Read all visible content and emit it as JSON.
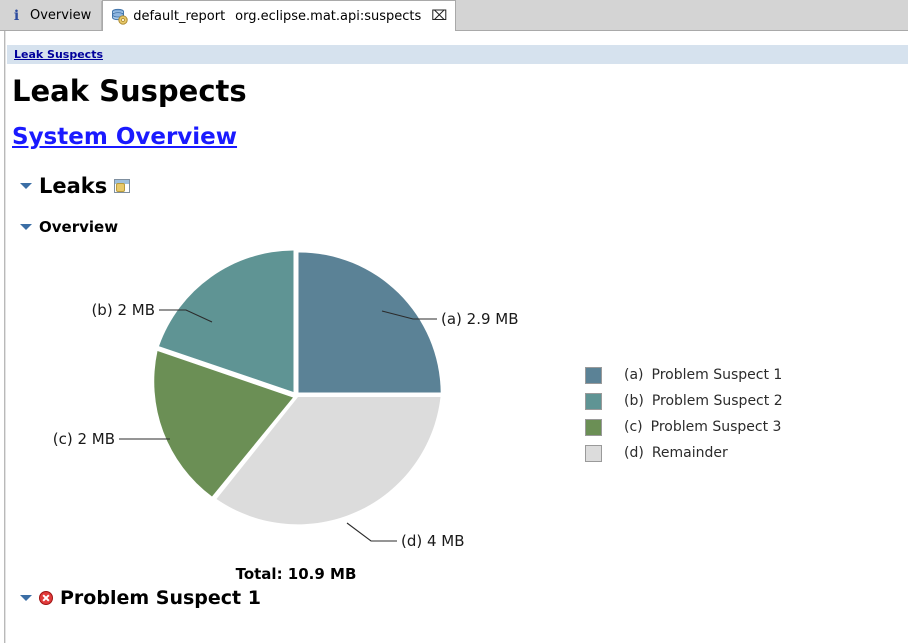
{
  "window": {
    "tabs": [
      {
        "id": "overview",
        "icon": "info-icon",
        "label": "Overview",
        "sublabel": "",
        "active": false,
        "closable": false
      },
      {
        "id": "default-report",
        "icon": "report-database-icon",
        "label": "default_report",
        "sublabel": "org.eclipse.mat.api:suspects",
        "active": true,
        "closable": true,
        "close_glyph": "⌧"
      }
    ]
  },
  "breadcrumb": {
    "items": [
      {
        "label": "Leak Suspects"
      }
    ]
  },
  "page": {
    "title": "Leak Suspects",
    "system_overview_link": "System Overview"
  },
  "sections": {
    "leaks": {
      "label": "Leaks",
      "icon": "report-window-icon",
      "expanded": true
    },
    "overview": {
      "label": "Overview",
      "expanded": true
    },
    "problem_suspect_1": {
      "label": "Problem Suspect 1",
      "icon": "error-icon",
      "expanded": true
    }
  },
  "chart_data": {
    "type": "pie",
    "title": "",
    "total_label": "Total: 10.9 MB",
    "total_value": 10.9,
    "unit": "MB",
    "categories": [
      "(a)",
      "(b)",
      "(c)",
      "(d)"
    ],
    "labels": [
      "(a)  2.9 MB",
      "(b)  2 MB",
      "(c)  2 MB",
      "(d)  4 MB"
    ],
    "values": [
      2.9,
      2.0,
      2.0,
      4.0
    ],
    "colors": [
      "#5b8296",
      "#5f9494",
      "#6b8f55",
      "#dcdcdc"
    ],
    "legend_position": "right",
    "legend": [
      {
        "key": "(a)",
        "name": "Problem Suspect 1",
        "color": "#5b8296"
      },
      {
        "key": "(b)",
        "name": "Problem Suspect 2",
        "color": "#5f9494"
      },
      {
        "key": "(c)",
        "name": "Problem Suspect 3",
        "color": "#6b8f55"
      },
      {
        "key": "(d)",
        "name": "Remainder",
        "color": "#dcdcdc"
      }
    ]
  },
  "colors": {
    "breadcrumb_bg": "#d6e2ee",
    "link": "#1a1aff",
    "breadcrumb_link": "#00009c",
    "tabbar_bg": "#d4d4d4",
    "twisty": "#3b6ea5"
  }
}
